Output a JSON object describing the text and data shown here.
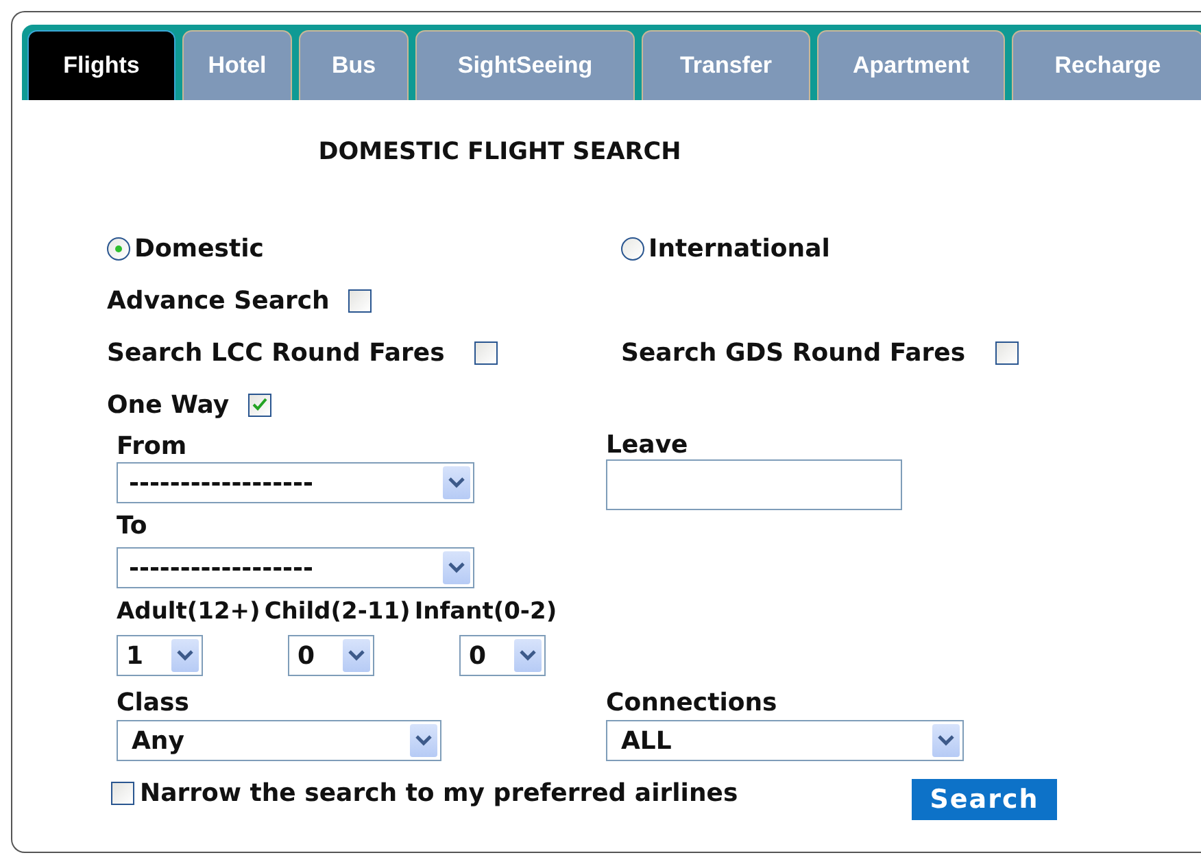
{
  "tabs": [
    {
      "label": "Flights",
      "selected": true
    },
    {
      "label": "Hotel",
      "selected": false
    },
    {
      "label": "Bus",
      "selected": false
    },
    {
      "label": "SightSeeing",
      "selected": false
    },
    {
      "label": "Transfer",
      "selected": false
    },
    {
      "label": "Apartment",
      "selected": false
    },
    {
      "label": "Recharge",
      "selected": false
    }
  ],
  "title": "DOMESTIC FLIGHT SEARCH",
  "trip_scope": [
    {
      "label": "Domestic",
      "selected": true
    },
    {
      "label": "International",
      "selected": false
    }
  ],
  "advance_search": {
    "label": "Advance Search",
    "checked": false
  },
  "round_fares": [
    {
      "label": "Search LCC Round Fares",
      "checked": false
    },
    {
      "label": "Search GDS Round Fares",
      "checked": false
    }
  ],
  "one_way": {
    "label": "One Way",
    "checked": true
  },
  "from": {
    "label": "From",
    "value": "------------------"
  },
  "leave": {
    "label": "Leave"
  },
  "to": {
    "label": "To",
    "value": "------------------"
  },
  "passengers": [
    {
      "label": "Adult(12+)",
      "value": "1"
    },
    {
      "label": "Child(2-11)",
      "value": "0"
    },
    {
      "label": "Infant(0-2)",
      "value": "0"
    }
  ],
  "class": {
    "label": "Class",
    "value": "Any"
  },
  "connections": {
    "label": "Connections",
    "value": "ALL"
  },
  "preferred_airlines": {
    "label": "Narrow the search to my preferred airlines",
    "checked": false
  },
  "search_button": "Search"
}
